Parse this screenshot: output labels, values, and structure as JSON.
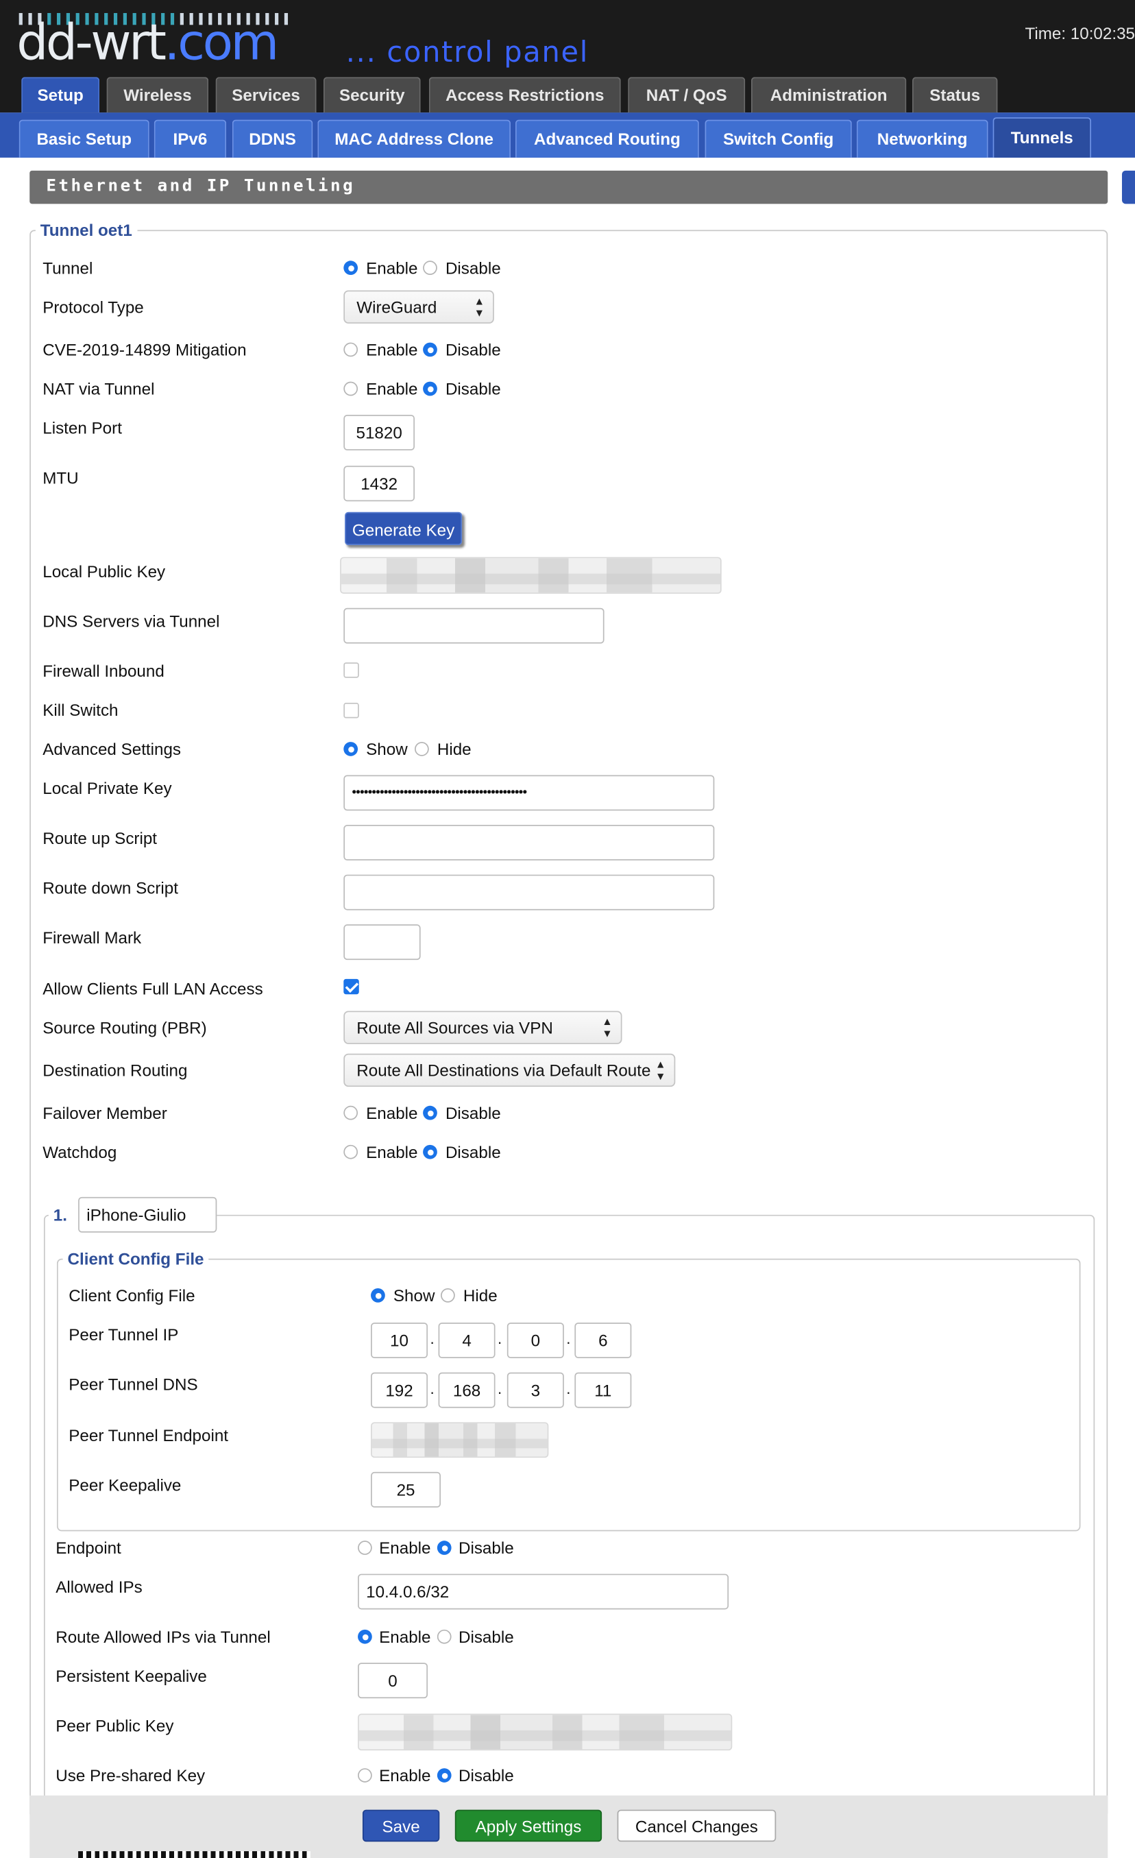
{
  "header": {
    "logo_text": "dd-wrt",
    "logo_suffix": ".com",
    "subtitle": "... control panel",
    "time": "Time: 10:02:35"
  },
  "tabs": [
    "Setup",
    "Wireless",
    "Services",
    "Security",
    "Access Restrictions",
    "NAT / QoS",
    "Administration",
    "Status"
  ],
  "active_tab": "Setup",
  "subtabs": [
    "Basic Setup",
    "IPv6",
    "DDNS",
    "MAC Address Clone",
    "Advanced Routing",
    "Switch Config",
    "Networking",
    "Tunnels"
  ],
  "active_subtab": "Tunnels",
  "section_title": "Ethernet and IP Tunneling",
  "tunnel": {
    "legend": "Tunnel oet1",
    "tunnel_label": "Tunnel",
    "enable": "Enable",
    "disable": "Disable",
    "show": "Show",
    "hide": "Hide",
    "protocol_label": "Protocol Type",
    "protocol_value": "WireGuard",
    "cve_label": "CVE-2019-14899 Mitigation",
    "nat_label": "NAT via Tunnel",
    "listen_port_label": "Listen Port",
    "listen_port_value": "51820",
    "mtu_label": "MTU",
    "mtu_value": "1432",
    "generate_key": "Generate Key",
    "local_public_key_label": "Local Public Key",
    "dns_label": "DNS Servers via Tunnel",
    "dns_value": "",
    "firewall_inbound_label": "Firewall Inbound",
    "kill_switch_label": "Kill Switch",
    "advanced_label": "Advanced Settings",
    "local_private_key_label": "Local Private Key",
    "local_private_key_value": "••••••••••••••••••••••••••••••••••••••••••••",
    "route_up_label": "Route up Script",
    "route_down_label": "Route down Script",
    "fwmark_label": "Firewall Mark",
    "allow_lan_label": "Allow Clients Full LAN Access",
    "source_routing_label": "Source Routing (PBR)",
    "source_routing_value": "Route All Sources via VPN",
    "dest_routing_label": "Destination Routing",
    "dest_routing_value": "Route All Destinations via Default Route",
    "failover_label": "Failover Member",
    "watchdog_label": "Watchdog"
  },
  "peer": {
    "index": "1.",
    "name": "iPhone-Giulio",
    "client_legend": "Client Config File",
    "client_config_label": "Client Config File",
    "peer_ip_label": "Peer Tunnel IP",
    "peer_ip": [
      "10",
      "4",
      "0",
      "6"
    ],
    "peer_dns_label": "Peer Tunnel DNS",
    "peer_dns": [
      "192",
      "168",
      "3",
      "11"
    ],
    "peer_endpoint_label": "Peer Tunnel Endpoint",
    "peer_keepalive_label": "Peer Keepalive",
    "peer_keepalive_value": "25",
    "endpoint_label": "Endpoint",
    "allowed_ips_label": "Allowed IPs",
    "allowed_ips_value": "10.4.0.6/32",
    "route_allowed_label": "Route Allowed IPs via Tunnel",
    "persistent_keepalive_label": "Persistent Keepalive",
    "persistent_keepalive_value": "0",
    "peer_public_key_label": "Peer Public Key",
    "psk_label": "Use Pre-shared Key",
    "dot": "."
  },
  "footer": {
    "save": "Save",
    "apply": "Apply Settings",
    "cancel": "Cancel Changes"
  }
}
